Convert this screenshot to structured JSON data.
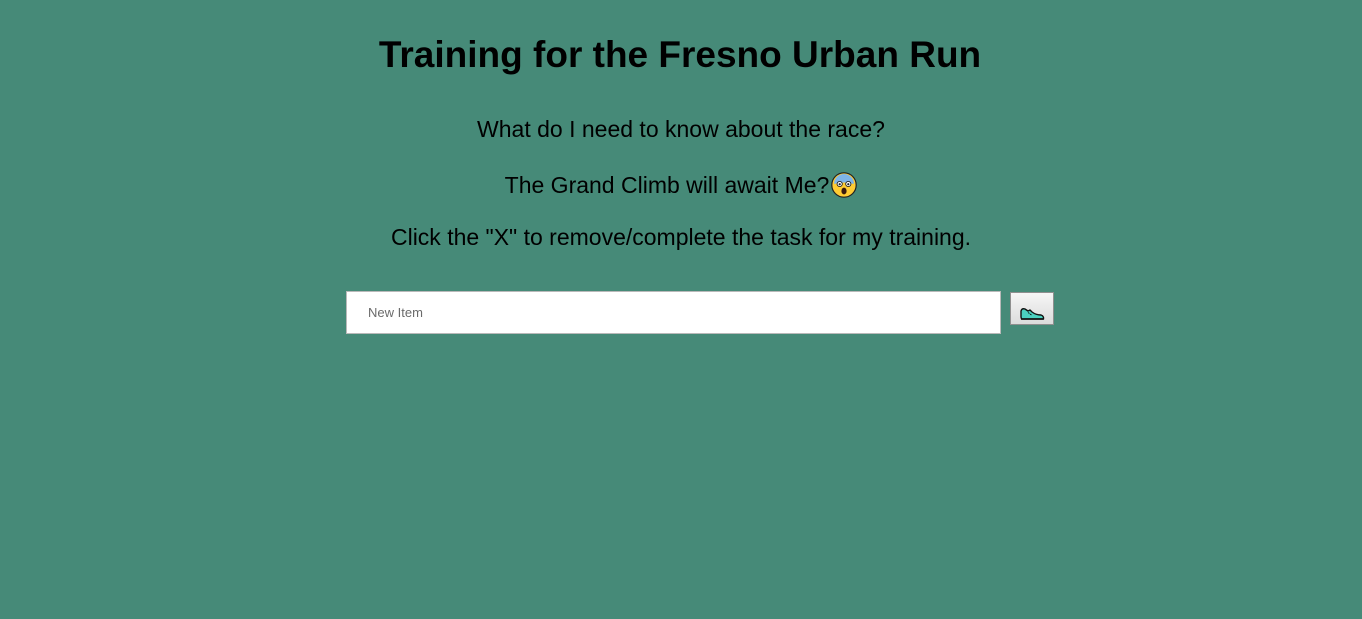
{
  "header": {
    "title": "Training for the Fresno Urban Run"
  },
  "intro": {
    "question": "What do I need to know about the race?",
    "climb_text": "The Grand Climb will await Me?",
    "climb_emoji": "face-screaming-in-fear-icon",
    "instructions": "Click the \"X\" to remove/complete the task for my training."
  },
  "form": {
    "input_placeholder": "New Item",
    "input_value": "",
    "add_button_icon": "running-shoe-icon"
  },
  "colors": {
    "background": "#468a78"
  }
}
